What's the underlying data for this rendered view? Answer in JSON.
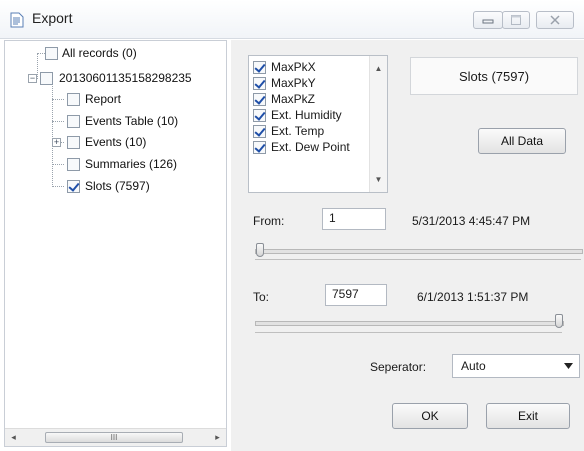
{
  "window": {
    "title": "Export"
  },
  "tree": {
    "root": {
      "label": "All records (0)"
    },
    "session": {
      "label": "20130601135158298235"
    },
    "children": [
      {
        "label": "Report",
        "checked": false
      },
      {
        "label": "Events Table (10)",
        "checked": false
      },
      {
        "label": "Events (10)",
        "checked": false
      },
      {
        "label": "Summaries (126)",
        "checked": false
      },
      {
        "label": "Slots (7597)",
        "checked": true
      }
    ],
    "scroll_thumb_glyph": "III"
  },
  "channels": [
    {
      "label": "MaxPkX",
      "checked": true
    },
    {
      "label": "MaxPkY",
      "checked": true
    },
    {
      "label": "MaxPkZ",
      "checked": true
    },
    {
      "label": "Ext. Humidity",
      "checked": true
    },
    {
      "label": "Ext. Temp",
      "checked": true
    },
    {
      "label": "Ext. Dew Point",
      "checked": true
    }
  ],
  "slots_display": "Slots (7597)",
  "all_data_label": "All Data",
  "range": {
    "from_label": "From:",
    "from_value": "1",
    "from_time": "5/31/2013 4:45:47 PM",
    "from_slider_fraction": 0,
    "to_label": "To:",
    "to_value": "7597",
    "to_time": "6/1/2013 1:51:37 PM",
    "to_slider_fraction": 1
  },
  "separator": {
    "label": "Seperator:",
    "value": "Auto"
  },
  "buttons": {
    "ok": "OK",
    "exit": "Exit"
  },
  "icons": {
    "app": "document-icon",
    "minimize": "minimize-icon",
    "maximize": "maximize-icon",
    "close": "close-icon"
  },
  "colors": {
    "check": "#1f4fa8",
    "titlebar": "#f1f4f8",
    "panel": "#f0f0f0"
  }
}
